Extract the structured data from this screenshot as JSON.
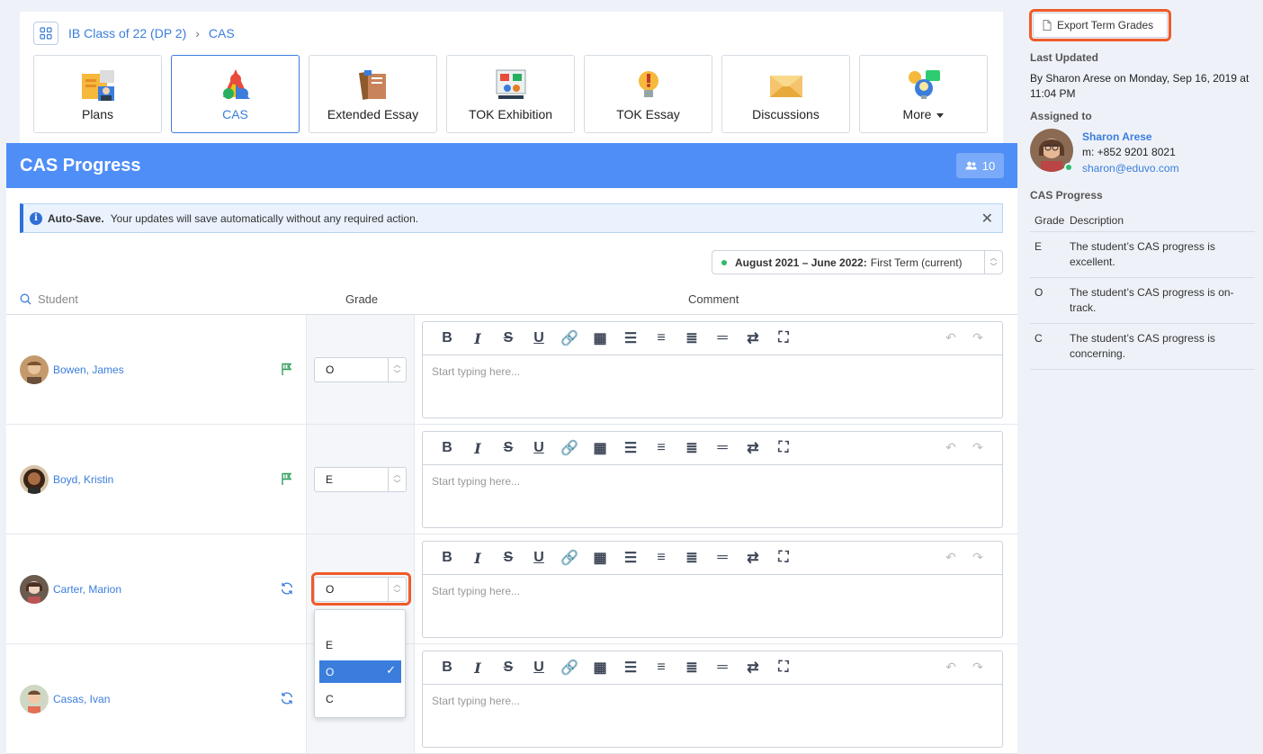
{
  "breadcrumb": {
    "class_name": "IB Class of 22 (DP 2)",
    "current": "CAS"
  },
  "tiles": [
    {
      "label": "Plans",
      "icon": "plans-icon"
    },
    {
      "label": "CAS",
      "icon": "cas-icon"
    },
    {
      "label": "Extended Essay",
      "icon": "books-icon"
    },
    {
      "label": "TOK Exhibition",
      "icon": "exhibition-icon"
    },
    {
      "label": "TOK Essay",
      "icon": "lightbulb-icon"
    },
    {
      "label": "Discussions",
      "icon": "envelope-icon"
    },
    {
      "label": "More",
      "icon": "chat-bulb-icon"
    }
  ],
  "panel": {
    "title": "CAS Progress",
    "student_count": "10"
  },
  "alert": {
    "title": "Auto-Save.",
    "text": "Your updates will save automatically without any required action."
  },
  "term": {
    "range": "August 2021 – June 2022:",
    "name": "First Term (current)"
  },
  "columns": {
    "student": "Student",
    "grade": "Grade",
    "comment": "Comment"
  },
  "editor": {
    "placeholder": "Start typing here..."
  },
  "students": [
    {
      "name": "Bowen, James",
      "grade": "O",
      "status": "flag-icon"
    },
    {
      "name": "Boyd, Kristin",
      "grade": "E",
      "status": "flag-icon"
    },
    {
      "name": "Carter, Marion",
      "grade": "O",
      "status": "sync-icon"
    },
    {
      "name": "Casas, Ivan",
      "grade": "",
      "status": "sync-icon"
    }
  ],
  "dropdown": {
    "options": [
      "E",
      "O",
      "C"
    ],
    "selected": "O"
  },
  "sidebar": {
    "export_label": "Export Term Grades",
    "last_updated_title": "Last Updated",
    "last_updated_text": "By Sharon Arese on Monday, Sep 16, 2019 at 11:04 PM",
    "assigned_title": "Assigned to",
    "assignee_name": "Sharon Arese",
    "assignee_phone": "m: +852 9201 8021",
    "assignee_email": "sharon@eduvo.com",
    "progress_title": "CAS Progress",
    "grade_header": "Grade",
    "desc_header": "Description",
    "grades": [
      {
        "grade": "E",
        "desc": "The student’s CAS progress is excellent."
      },
      {
        "grade": "O",
        "desc": "The student’s CAS progress is on-track."
      },
      {
        "grade": "C",
        "desc": "The student’s CAS progress is concerning."
      }
    ]
  },
  "colors": {
    "accent": "#3b7ddd",
    "header": "#4f8ef7",
    "highlight": "#f05a28",
    "online": "#2bbd6b"
  }
}
